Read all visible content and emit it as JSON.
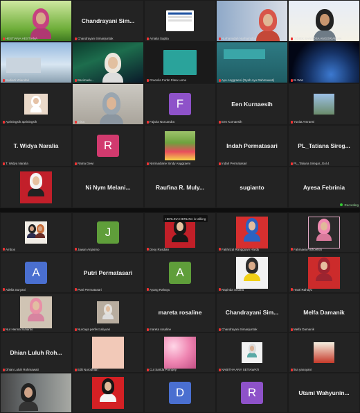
{
  "top_panel": {
    "rows": [
      [
        {
          "kind": "video",
          "label": "HESTIANA HESTIANA",
          "scene": "grass"
        },
        {
          "kind": "name",
          "display": "Chandrayani Sim...",
          "label": "Chandrayani Simanjuntak"
        },
        {
          "kind": "video",
          "label": "Amalia Saptia",
          "scene": "slide"
        },
        {
          "kind": "video",
          "label": "Nurhamidah Nurhamidah",
          "scene": "hijab-building"
        },
        {
          "kind": "video",
          "label": "DIDIEK SANTOSA ANGGRIAWAN",
          "scene": "man-banner"
        }
      ],
      [
        {
          "kind": "video",
          "label": "Sudiarti Wiandari",
          "scene": "building"
        },
        {
          "kind": "video",
          "label": "Basimadu...",
          "scene": "aurora"
        },
        {
          "kind": "video",
          "label": "Gracelia Fortin Fitea Lemo",
          "scene": "teal-slide"
        },
        {
          "kind": "video",
          "label": "Ayu Anggraeni (Dyah Ayu Rahmawati)",
          "scene": "green-slide"
        },
        {
          "kind": "video",
          "label": "Bi Wan",
          "scene": "earth"
        }
      ],
      [
        {
          "kind": "photo",
          "label": "Apriningsih apriningsih",
          "scene": "hijab-small"
        },
        {
          "kind": "video",
          "label": "mirta",
          "scene": "woman-room"
        },
        {
          "kind": "avatar",
          "letter": "F",
          "color": "#8e52c9",
          "label": "Fajaria Nurcandra"
        },
        {
          "kind": "name",
          "display": "Een Kurnaesih",
          "label": "Een Kurnaesih"
        },
        {
          "kind": "photo",
          "label": "Yunita Amraeni",
          "scene": "building-small"
        }
      ],
      [
        {
          "kind": "name",
          "display": "T. Widya Naralia",
          "label": "T. Widya Naralia"
        },
        {
          "kind": "avatar",
          "letter": "R",
          "color": "#d13a6e",
          "label": "Ratna Dewi"
        },
        {
          "kind": "photo",
          "label": "Nisrinadiane Sindy Anggraeni",
          "scene": "tulips"
        },
        {
          "kind": "name",
          "display": "Indah Permatasari",
          "label": "Indah Permatasari"
        },
        {
          "kind": "name",
          "display": "PL_Tatiana Sireg...",
          "label": "PL_Tatiana Siregar_Gol.4"
        }
      ],
      [
        {
          "kind": "photo",
          "label": "",
          "scene": "red-hijab"
        },
        {
          "kind": "name",
          "display": "Ni Nym Melani...",
          "label": ""
        },
        {
          "kind": "name",
          "display": "Raufina R. Muly...",
          "label": ""
        },
        {
          "kind": "name",
          "display": "sugianto",
          "label": ""
        },
        {
          "kind": "name",
          "display": "Ayesa Febrinia",
          "label": ""
        }
      ]
    ],
    "status_text": "Recording"
  },
  "bottom_panel": {
    "tooltip": "HERLINA HERLINA is talking",
    "rows": [
      [
        {
          "kind": "photo",
          "label": "Ambos",
          "scene": "couple"
        },
        {
          "kind": "avatar",
          "letter": "J",
          "color": "#5f9e3a",
          "label": "Jawan Anjasmo"
        },
        {
          "kind": "photo",
          "label": "Desy Rusdian",
          "scene": "red-hijab-2"
        },
        {
          "kind": "photo",
          "label": "Fakhrizal Rangguwo Hardy",
          "scene": "blue-hijab"
        },
        {
          "kind": "photo",
          "label": "Fahmaea Fathoelsin",
          "scene": "couple-pink"
        }
      ],
      [
        {
          "kind": "avatar",
          "letter": "A",
          "color": "#4a6fd0",
          "label": "Adelia Suryani"
        },
        {
          "kind": "name",
          "display": "Putri Permatasari",
          "label": "Putri Permatasari"
        },
        {
          "kind": "avatar",
          "letter": "A",
          "color": "#5f9e3a",
          "label": "Ayang Rahayu"
        },
        {
          "kind": "photo",
          "label": "Rapinda Sinaria",
          "scene": "yellow-shirt"
        },
        {
          "kind": "photo",
          "label": "Hasti Rahayu",
          "scene": "maroon-hijab"
        }
      ],
      [
        {
          "kind": "photo",
          "label": "Nur Henna Sufianto",
          "scene": "pink-hijab"
        },
        {
          "kind": "photo",
          "label": "Nurcaya perfect aliyuak",
          "scene": "hijab-room"
        },
        {
          "kind": "name",
          "display": "mareta rosaline",
          "label": "mareta rosaline"
        },
        {
          "kind": "name",
          "display": "Chandrayani Sim...",
          "label": "Chandrayani Simanjuntak"
        },
        {
          "kind": "name",
          "display": "Melfa Damanik",
          "label": "Melfa Damanik"
        }
      ],
      [
        {
          "kind": "name",
          "display": "Dhian Luluh Roh...",
          "label": "Dhian Luluh Rohmawati"
        },
        {
          "kind": "photo",
          "label": "Edit Nurodhian",
          "scene": "peach"
        },
        {
          "kind": "photo",
          "label": "Cut Sarida Pompey",
          "scene": "pink-flowers"
        },
        {
          "kind": "photo",
          "label": "NABITHA ANY SETIAWATI",
          "scene": "small-figure"
        },
        {
          "kind": "photo",
          "label": "lisa yanuyani",
          "scene": "red-item"
        }
      ],
      [
        {
          "kind": "photo",
          "label": "",
          "scene": "desk"
        },
        {
          "kind": "photo",
          "label": "",
          "scene": "man-red"
        },
        {
          "kind": "avatar",
          "letter": "D",
          "color": "#4a6fd0",
          "label": ""
        },
        {
          "kind": "avatar",
          "letter": "R",
          "color": "#8e52c9",
          "label": ""
        },
        {
          "kind": "name",
          "display": "Utami Wahyunin...",
          "label": ""
        }
      ]
    ]
  }
}
